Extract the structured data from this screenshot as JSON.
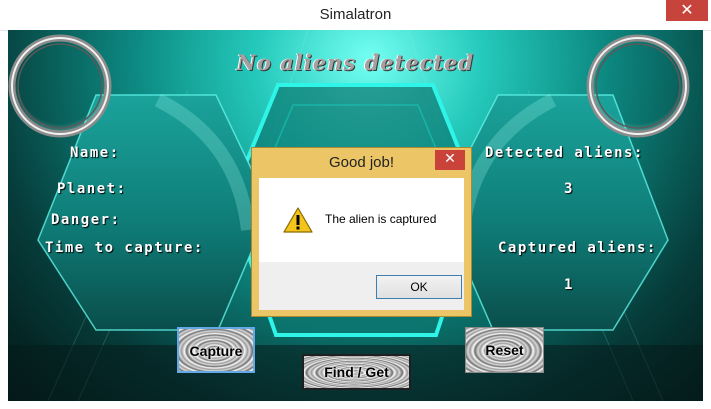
{
  "window": {
    "title": "Simalatron",
    "close_glyph": "✕"
  },
  "main": {
    "heading": "No aliens detected",
    "labels": {
      "name": "Name:",
      "planet": "Planet:",
      "danger": "Danger:",
      "time_to_capture": "Time to capture:",
      "detected_aliens": "Detected aliens:",
      "captured_aliens": "Captured aliens:"
    },
    "values": {
      "detected_aliens": "3",
      "captured_aliens": "1"
    },
    "buttons": {
      "capture": "Capture",
      "find_get": "Find / Get",
      "reset": "Reset"
    },
    "colors": {
      "accent": "#1ee6da",
      "panel": "#138e88"
    }
  },
  "dialog": {
    "title": "Good job!",
    "message": "The alien is captured",
    "icon": "warning-icon",
    "ok_label": "OK",
    "close_glyph": "✕"
  }
}
